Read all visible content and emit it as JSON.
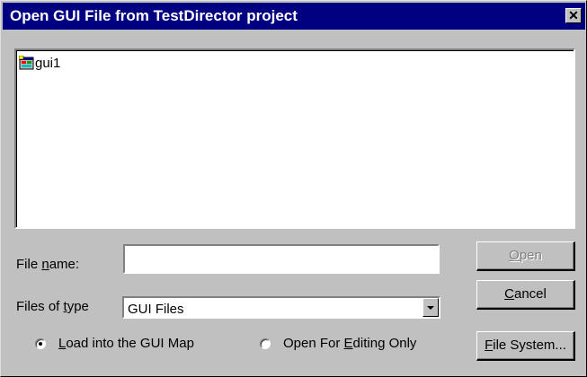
{
  "window": {
    "title": "Open GUI File from TestDirector project",
    "close_glyph": "✕"
  },
  "file_list": {
    "items": [
      {
        "label": "gui1",
        "icon": "gui-file-icon"
      }
    ]
  },
  "file_name": {
    "label_prefix": "File ",
    "label_underline": "n",
    "label_suffix": "ame:",
    "value": ""
  },
  "file_type": {
    "label_prefix": "Files of ",
    "label_underline": "t",
    "label_suffix": "ype",
    "selected": "GUI Files"
  },
  "radios": {
    "load": {
      "prefix": "",
      "underline": "L",
      "suffix": "oad into the GUI Map",
      "checked": true
    },
    "edit": {
      "prefix": "Open For ",
      "underline": "E",
      "suffix": "diting Only",
      "checked": false
    }
  },
  "buttons": {
    "open": {
      "underline": "O",
      "suffix": "pen",
      "enabled": false
    },
    "cancel": {
      "underline": "C",
      "suffix": "ancel",
      "enabled": true
    },
    "file_system": {
      "underline": "F",
      "suffix": "ile System...",
      "enabled": true
    }
  }
}
